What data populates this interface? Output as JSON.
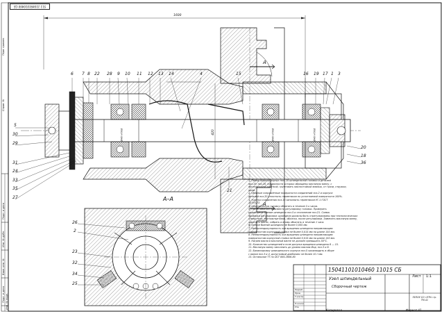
{
  "stamp": "511 110491010460 СБ",
  "overall_dimension": "1600",
  "section_title": "А–А",
  "section_marks": [
    "А",
    "А"
  ],
  "diameter_labels": [
    "Ø40 H7/k6",
    "Ø40 H7/k6",
    "Ø40 H7/k6"
  ],
  "center_dim": "420",
  "callouts_left": [
    "5",
    "30",
    "29",
    "31",
    "24",
    "33",
    "35",
    "27"
  ],
  "callouts_top": [
    "6",
    "7",
    "8",
    "22",
    "28",
    "9",
    "10",
    "11",
    "12",
    "13",
    "14",
    "4",
    "15",
    "16",
    "19",
    "17",
    "1",
    "3"
  ],
  "callouts_right": [
    "20",
    "18",
    "36"
  ],
  "callouts_misc": [
    "21"
  ],
  "callouts_section": [
    "26",
    "2",
    "23",
    "32",
    "34",
    "25"
  ],
  "notes": [
    "1. Перед сборкой корпус поз. 10 шпиндельной головки и деталей",
    "поз.19, поз.20, поверхности которых обращены масляную ванну, с",
    "последующей очисткой, грунтовать маслостойкой эмалью, от грязи, стружки,",
    "пыли.",
    "2. Сборные сопряжённые поверхности соединений поз.2 и корпуса",
    "деталей поз.20 уплотнять герметиком по уплотняемой поверхности 100%.",
    "3. Участки соединения поз.16 заполнить герметиком УГ-1 ГОСТ",
    "10333-72.",
    "4. Шпиндельную головку обкатать в течение 2-х часов.",
    "5. После обкатки произвести регулировку головки. Проверить",
    "радиальное биение шпинделя поз.5 и отклонение поз.21. Схемы",
    "проверки регулировки: шпиндели должны быть отрегулированы при технологических",
    "отверстиях, монтажные базы, обкатка, после регулировки. Заменить масляную ванну,",
    "заменить масло, собрать и вновь обкатать в течение 1 часа.",
    "6. Осевое биение шпинделя не более 0,005 мм.",
    "7. Неперпендикулярность оси вращения шпинделя направляющим",
    "поверхностям корпусной стойки не более 0,015 мм на длине 150 мм.",
    "8. Неперпендикулярность оси вращения шпинделя направляющим",
    "поверхностям корпусной стойки не более 0,015 мм на длине 150 мм.",
    "9. Нагрев масла в масляной ванне не должен превышать 50°С.",
    "10. Количество шпинделей в поле допуска вращения шпинделя 6 — 15.",
    "11. Масляную ванну заполнить до уровня маслом Инд. поз.3 и 6.",
    "12. Балансировку шпиндельного корпуса поз.5 производить в сборе",
    "с валом поз.3 и 4, допустимый дисбаланс не более 10 г·мм.",
    "13. Остальные ТТ по ОСТ 885.2606-80"
  ],
  "title_block": {
    "code": "15041101010460 11015 СБ",
    "name": "Узел шпиндельный",
    "subtitle": "Сборочный чертеж",
    "organization": "ГБПОУ СО «ЭТК» гр. ТМ-41",
    "sheet": "Лист",
    "scale": "1:1",
    "mass": "",
    "rows": [
      "Разраб.",
      "Пров.",
      "Т.контр.",
      "Н.контр.",
      "Утв."
    ]
  },
  "bottom_labels": [
    "Копировал",
    "Формат А1"
  ],
  "side_labels": [
    "Перв. примен.",
    "Справ. №",
    "Подп. и дата",
    "Инв. № дубл.",
    "Взам. инв. №",
    "Подп. и дата",
    "Инв. № подл."
  ]
}
